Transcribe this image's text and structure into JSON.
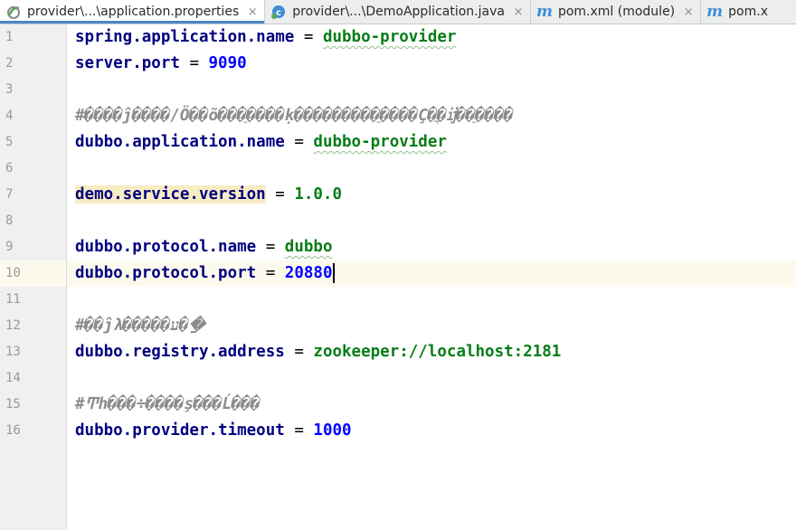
{
  "tabs": [
    {
      "label": "provider\\...\\application.properties",
      "icon": "properties-file-icon",
      "active": true
    },
    {
      "label": "provider\\...\\DemoApplication.java",
      "icon": "java-class-icon",
      "active": false
    },
    {
      "label": "pom.xml (module)",
      "icon": "maven-icon",
      "active": false
    },
    {
      "label": "pom.x",
      "icon": "maven-icon",
      "active": false
    }
  ],
  "close_glyph": "×",
  "lines": [
    {
      "n": "1",
      "key": "spring.application.name",
      "eq": " = ",
      "value": "dubbo-provider",
      "kind": "str"
    },
    {
      "n": "2",
      "key": "server.port",
      "eq": " = ",
      "value": "9090",
      "kind": "num"
    },
    {
      "n": "3"
    },
    {
      "n": "4",
      "comment": "#����ĵ����/Ö��õ���ֵ����ķ���������ֵ����Ç�ֲ�ĳ��ֵ����"
    },
    {
      "n": "5",
      "key": "dubbo.application.name",
      "eq": " = ",
      "value": "dubbo-provider",
      "kind": "str"
    },
    {
      "n": "6"
    },
    {
      "n": "7",
      "key": "demo.service.version",
      "eq": " = ",
      "value": "1.0.0",
      "kind": "ver"
    },
    {
      "n": "8"
    },
    {
      "n": "9",
      "key": "dubbo.protocol.name",
      "eq": " = ",
      "value": "dubbo",
      "kind": "str"
    },
    {
      "n": "10",
      "key": "dubbo.protocol.port",
      "eq": " = ",
      "value": "20880",
      "kind": "num"
    },
    {
      "n": "11"
    },
    {
      "n": "12",
      "comment": "#��ĵλ�����ע��ַ"
    },
    {
      "n": "13",
      "key": "dubbo.registry.address",
      "eq": " = ",
      "value": "zookeeper://localhost:2181",
      "kind": "str"
    },
    {
      "n": "14"
    },
    {
      "n": "15",
      "comment": "#Ͳh���÷����ş���Ĺ���"
    },
    {
      "n": "16",
      "key": "dubbo.provider.timeout",
      "eq": " = ",
      "value": "1000",
      "kind": "num"
    }
  ]
}
